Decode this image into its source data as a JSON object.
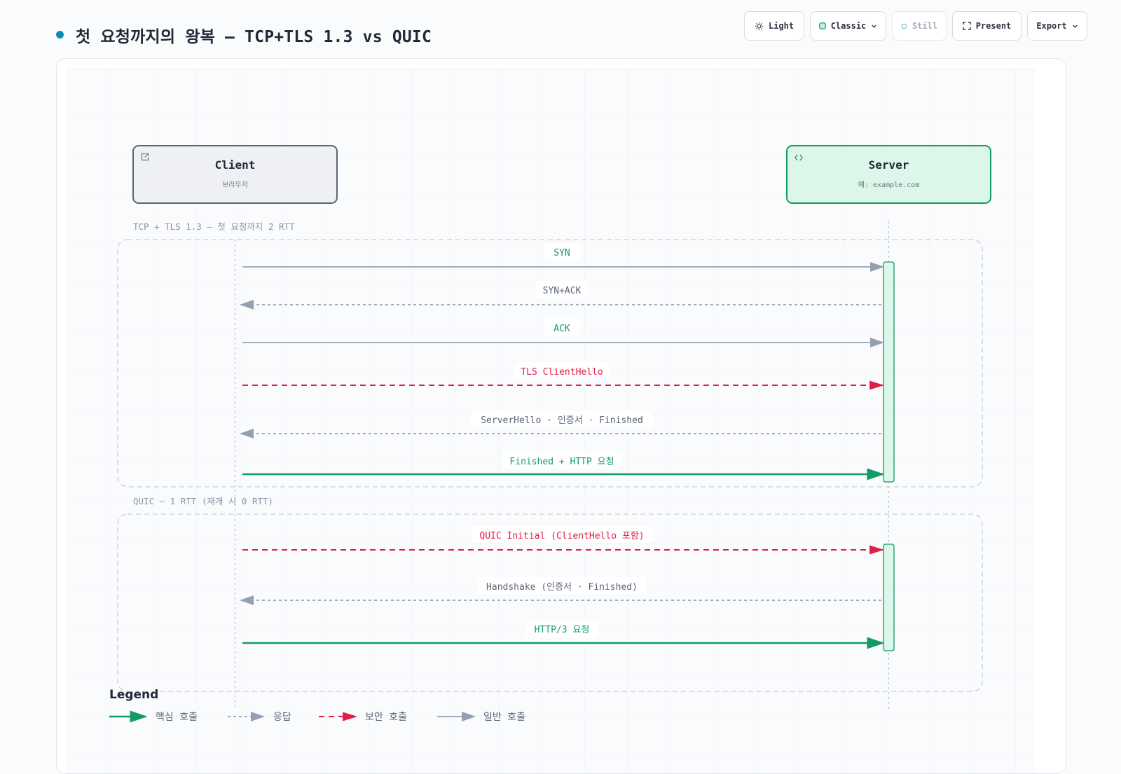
{
  "page": {
    "title": "첫 요청까지의 왕복 — TCP+TLS 1.3 vs QUIC",
    "accent": "#0e8bb4"
  },
  "toolbar": {
    "light": {
      "label": "Light",
      "icon": "sun-icon"
    },
    "theme": {
      "label": "Classic",
      "icon": "swatch-icon"
    },
    "still": {
      "label": "Still",
      "icon": "circle-icon"
    },
    "present": {
      "label": "Present",
      "icon": "fullscreen-icon"
    },
    "export": {
      "label": "Export",
      "icon": "chevron-down-icon"
    }
  },
  "participants": {
    "client": {
      "name": "Client",
      "subtitle": "브라우저",
      "icon": "external-link-icon",
      "fill": "#eef0f4",
      "stroke": "#5b6577"
    },
    "server": {
      "name": "Server",
      "subtitle": "예: example.com",
      "icon": "code-icon",
      "fill": "#dcf6ea",
      "stroke": "#139b65"
    }
  },
  "groups": [
    {
      "label": "TCP + TLS 1.3 — 첫 요청까지 2 RTT"
    },
    {
      "label": "QUIC — 1 RTT (재개 시 0 RTT)"
    }
  ],
  "messages": [
    {
      "label": "SYN",
      "direction": "to-server",
      "kind": "normal"
    },
    {
      "label": "SYN+ACK",
      "direction": "to-client",
      "kind": "response"
    },
    {
      "label": "ACK",
      "direction": "to-server",
      "kind": "normal"
    },
    {
      "label": "TLS ClientHello",
      "direction": "to-server",
      "kind": "security"
    },
    {
      "label": "ServerHello · 인증서 · Finished",
      "direction": "to-client",
      "kind": "response"
    },
    {
      "label": "Finished + HTTP 요청",
      "direction": "to-server",
      "kind": "core"
    },
    {
      "label": "QUIC Initial (ClientHello 포함)",
      "direction": "to-server",
      "kind": "security"
    },
    {
      "label": "Handshake (인증서 · Finished)",
      "direction": "to-client",
      "kind": "response"
    },
    {
      "label": "HTTP/3 요청",
      "direction": "to-server",
      "kind": "core"
    }
  ],
  "colors": {
    "core": "#139b65",
    "response": "#94a0b2",
    "security": "#e11d48",
    "normal": "#94a0b2",
    "normal_label": "#139b65",
    "response_label": "#5b6577",
    "group_border": "#c9ced6",
    "group_label": "#8a94a6"
  },
  "legend": {
    "title": "Legend",
    "items": [
      {
        "label": "핵심 호출",
        "kind": "core"
      },
      {
        "label": "응답",
        "kind": "response"
      },
      {
        "label": "보안 호출",
        "kind": "security"
      },
      {
        "label": "일반 호출",
        "kind": "normal"
      }
    ]
  }
}
